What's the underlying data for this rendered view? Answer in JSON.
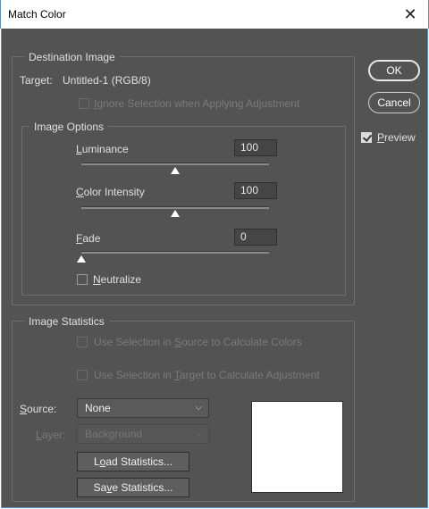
{
  "window": {
    "title": "Match Color",
    "close_glyph": "✕"
  },
  "destination": {
    "group_label": "Destination Image",
    "target_label": "Target:",
    "target_value": "Untitled-1 (RGB/8)",
    "ignore_selection": {
      "prefix": "",
      "underlined": "I",
      "rest": "gnore Selection when Applying Adjustment",
      "checked": false,
      "enabled": false
    }
  },
  "image_options": {
    "group_label": "Image Options",
    "luminance": {
      "underlined": "L",
      "rest": "uminance",
      "value": "100",
      "slider_fraction": 0.5
    },
    "color_intensity": {
      "underlined": "C",
      "rest": "olor Intensity",
      "value": "100",
      "slider_fraction": 0.5
    },
    "fade": {
      "underlined": "F",
      "rest": "ade",
      "value": "0",
      "slider_fraction": 0.0
    },
    "neutralize": {
      "underlined": "N",
      "rest": "eutralize",
      "checked": false
    }
  },
  "image_statistics": {
    "group_label": "Image Statistics",
    "use_source": {
      "prefix": "Use Selection in ",
      "underlined": "S",
      "rest": "ource to Calculate Colors",
      "checked": false,
      "enabled": false
    },
    "use_target": {
      "prefix": "Use Selection in ",
      "underlined": "T",
      "rest": "arget to Calculate Adjustment",
      "checked": false,
      "enabled": false
    },
    "source": {
      "underlined": "S",
      "rest": "ource:",
      "value": "None"
    },
    "layer": {
      "underlined": "L",
      "rest": "ayer:",
      "value": "Background",
      "enabled": false
    },
    "load_button": {
      "prefix": "L",
      "underlined": "o",
      "rest": "ad Statistics..."
    },
    "save_button": {
      "prefix": "Sa",
      "underlined": "v",
      "rest": "e Statistics..."
    }
  },
  "buttons": {
    "ok": "OK",
    "cancel": "Cancel"
  },
  "preview": {
    "underlined": "P",
    "rest": "review",
    "checked": true
  },
  "icons": {
    "chevron": "⌵"
  }
}
